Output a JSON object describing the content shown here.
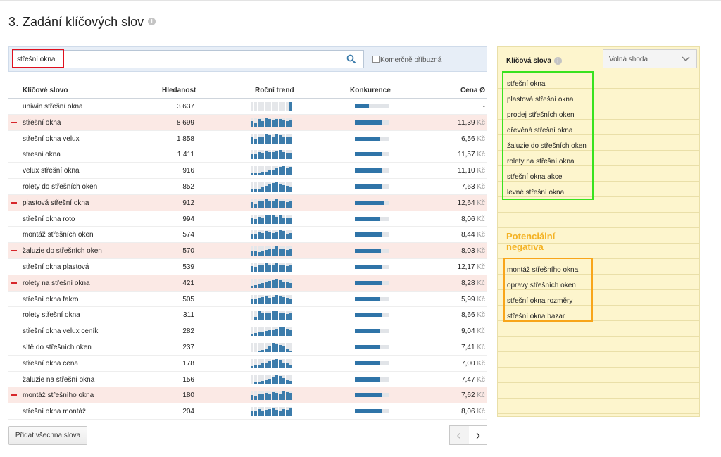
{
  "title": "3. Zadání klíčových slov",
  "search": {
    "value": "střešní okna",
    "checkbox_label": "Komerčně příbuzná"
  },
  "table": {
    "headers": {
      "keyword": "Klíčové slovo",
      "volume": "Hledanost",
      "trend": "Roční trend",
      "competition": "Konkurence",
      "price": "Cena Ø"
    },
    "currency": "Kč",
    "rows": [
      {
        "keyword": "uniwin střešní okna",
        "volume": "3 637",
        "price": "-",
        "negative": false,
        "competition": 0.42,
        "trend": [
          0,
          0,
          0,
          0,
          0,
          0,
          0,
          0,
          0,
          0,
          0,
          1
        ]
      },
      {
        "keyword": "střešní okna",
        "volume": "8 699",
        "price": "11,39",
        "negative": true,
        "competition": 0.8,
        "trend": [
          0.7,
          0.5,
          0.9,
          0.7,
          1,
          0.9,
          0.8,
          0.9,
          0.9,
          0.8,
          0.7,
          0.8
        ]
      },
      {
        "keyword": "střešní okna velux",
        "volume": "1 858",
        "price": "6,56",
        "negative": false,
        "competition": 0.75,
        "trend": [
          0.7,
          0.5,
          0.8,
          0.7,
          1,
          0.9,
          0.8,
          1,
          0.9,
          0.8,
          0.7,
          0.8
        ]
      },
      {
        "keyword": "stresni okna",
        "volume": "1 411",
        "price": "11,57",
        "negative": false,
        "competition": 0.8,
        "trend": [
          0.6,
          0.5,
          0.8,
          0.7,
          0.9,
          0.8,
          0.8,
          0.9,
          1,
          0.8,
          0.7,
          0.7
        ]
      },
      {
        "keyword": "velux střešní okna",
        "volume": "916",
        "price": "11,10",
        "negative": false,
        "competition": 0.8,
        "trend": [
          0.2,
          0.2,
          0.3,
          0.4,
          0.4,
          0.5,
          0.6,
          0.8,
          0.9,
          1,
          0.8,
          0.9
        ]
      },
      {
        "keyword": "rolety do střešních oken",
        "volume": "852",
        "price": "7,63",
        "negative": false,
        "competition": 0.8,
        "trend": [
          0.2,
          0.3,
          0.3,
          0.5,
          0.6,
          0.8,
          0.9,
          1,
          0.8,
          0.7,
          0.6,
          0.5
        ]
      },
      {
        "keyword": "plastová střešní okna",
        "volume": "912",
        "price": "12,64",
        "negative": true,
        "competition": 0.85,
        "trend": [
          0.6,
          0.4,
          0.8,
          0.7,
          0.9,
          0.7,
          0.8,
          1,
          0.8,
          0.7,
          0.6,
          0.8
        ]
      },
      {
        "keyword": "střešní okna roto",
        "volume": "994",
        "price": "8,06",
        "negative": false,
        "competition": 0.75,
        "trend": [
          0.6,
          0.5,
          0.8,
          0.7,
          0.9,
          1,
          0.9,
          0.8,
          0.9,
          0.7,
          0.6,
          0.7
        ]
      },
      {
        "keyword": "montáž střešních oken",
        "volume": "574",
        "price": "8,44",
        "negative": false,
        "competition": 0.8,
        "trend": [
          0.5,
          0.6,
          0.8,
          0.7,
          0.9,
          0.8,
          0.7,
          0.8,
          1,
          0.9,
          0.6,
          0.7
        ]
      },
      {
        "keyword": "žaluzie do střešních oken",
        "volume": "570",
        "price": "8,03",
        "negative": true,
        "competition": 0.78,
        "trend": [
          0.5,
          0.5,
          0.4,
          0.5,
          0.6,
          0.7,
          0.8,
          1,
          0.8,
          0.7,
          0.6,
          0.7
        ]
      },
      {
        "keyword": "střešní okna plastová",
        "volume": "539",
        "price": "12,17",
        "negative": false,
        "competition": 0.8,
        "trend": [
          0.6,
          0.5,
          0.8,
          0.7,
          0.9,
          0.7,
          0.8,
          1,
          0.8,
          0.7,
          0.6,
          0.8
        ]
      },
      {
        "keyword": "rolety na střešní okna",
        "volume": "421",
        "price": "8,28",
        "negative": true,
        "competition": 0.8,
        "trend": [
          0.2,
          0.3,
          0.4,
          0.5,
          0.6,
          0.8,
          0.9,
          1,
          0.9,
          0.7,
          0.6,
          0.5
        ]
      },
      {
        "keyword": "střešní okna fakro",
        "volume": "505",
        "price": "5,99",
        "negative": false,
        "competition": 0.75,
        "trend": [
          0.6,
          0.5,
          0.7,
          0.8,
          0.9,
          0.7,
          0.8,
          1,
          0.9,
          0.8,
          0.7,
          0.6
        ]
      },
      {
        "keyword": "rolety střešní okna",
        "volume": "311",
        "price": "8,66",
        "negative": false,
        "competition": 0.8,
        "trend": [
          0,
          0.3,
          0.9,
          0.8,
          0.7,
          0.8,
          0.9,
          1,
          0.8,
          0.7,
          0.6,
          0.7
        ]
      },
      {
        "keyword": "střešní okna velux ceník",
        "volume": "282",
        "price": "9,04",
        "negative": false,
        "competition": 0.75,
        "trend": [
          0.2,
          0.3,
          0.4,
          0.4,
          0.5,
          0.6,
          0.7,
          0.8,
          0.9,
          1,
          0.8,
          0.7
        ]
      },
      {
        "keyword": "sítě do střešních oken",
        "volume": "237",
        "price": "7,41",
        "negative": false,
        "competition": 0.75,
        "trend": [
          0,
          0,
          0.1,
          0.2,
          0.4,
          0.6,
          1,
          0.9,
          0.8,
          0.6,
          0.3,
          0.1
        ]
      },
      {
        "keyword": "střešní okna cena",
        "volume": "178",
        "price": "7,00",
        "negative": false,
        "competition": 0.75,
        "trend": [
          0.2,
          0.3,
          0.4,
          0.5,
          0.6,
          0.8,
          0.9,
          1,
          0.9,
          0.6,
          0.5,
          0.4
        ]
      },
      {
        "keyword": "žaluzie na střešní okna",
        "volume": "156",
        "price": "7,47",
        "negative": false,
        "competition": 0.75,
        "trend": [
          0,
          0.2,
          0.3,
          0.4,
          0.5,
          0.6,
          0.8,
          1,
          0.9,
          0.7,
          0.5,
          0.4
        ]
      },
      {
        "keyword": "montáž střešního okna",
        "volume": "180",
        "price": "7,62",
        "negative": true,
        "competition": 0.8,
        "trend": [
          0.5,
          0.4,
          0.7,
          0.6,
          0.8,
          0.7,
          0.9,
          0.8,
          0.7,
          1,
          0.9,
          0.8
        ]
      },
      {
        "keyword": "střešní okna montáž",
        "volume": "204",
        "price": "8,06",
        "negative": false,
        "competition": 0.8,
        "trend": [
          0.6,
          0.5,
          0.8,
          0.6,
          0.7,
          0.8,
          0.9,
          0.7,
          0.6,
          0.8,
          0.7,
          0.9
        ]
      }
    ]
  },
  "footer": {
    "add_all": "Přidat všechna slova",
    "prev_icon": "chevron-left-icon",
    "next_icon": "chevron-right-icon"
  },
  "panel": {
    "title": "Klíčová slova",
    "match_type": "Volná shoda",
    "keywords": [
      "střešní okna",
      "plastová střešní okna",
      "prodej střešních oken",
      "dřevěná střešní okna",
      "žaluzie do střešních oken",
      "rolety na střešní okna",
      "střešní okna akce",
      "levné střešní okna"
    ],
    "potential_title": "Potenciální negativa",
    "negatives": [
      "montáž střešního okna",
      "opravy střešních oken",
      "střešní okna rozměry",
      "střešní okna bazar"
    ]
  },
  "colors": {
    "accent_blue": "#2f74a8",
    "negative_row": "#fbe9e5",
    "minus_red": "#d7262b",
    "panel_bg": "#fdf5cd",
    "potential_orange": "#f4b223",
    "highlight_red": "#e0101e",
    "highlight_green": "#39e21f",
    "highlight_orange": "#f8a51a"
  }
}
